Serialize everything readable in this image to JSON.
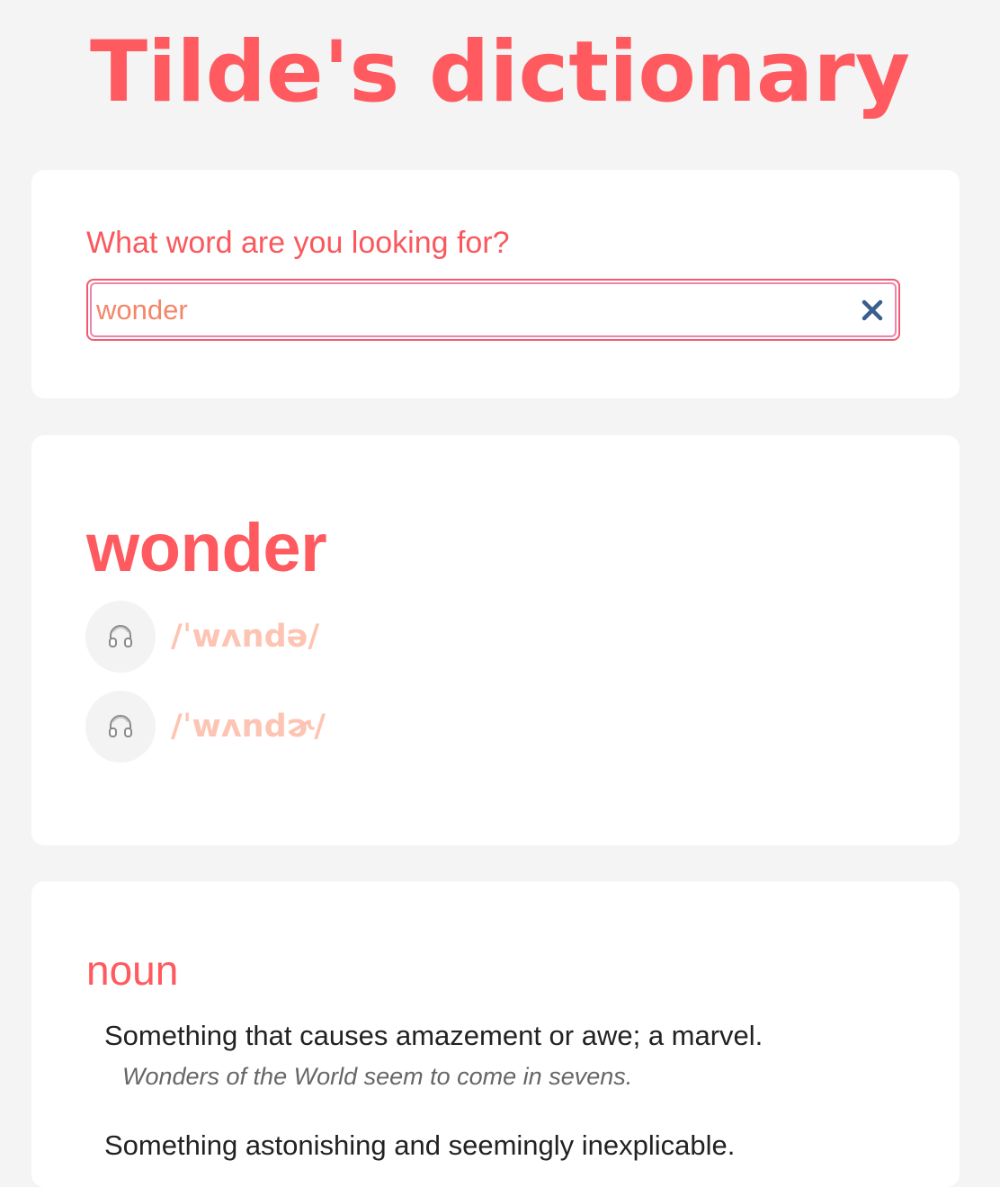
{
  "app": {
    "title": "Tilde's dictionary"
  },
  "search": {
    "label": "What word are you looking for?",
    "value": "wonder",
    "clear_icon": "close-x-icon"
  },
  "entry": {
    "word": "wonder",
    "phonetics": [
      {
        "text": "/ˈwʌndə/",
        "icon": "headphones-icon"
      },
      {
        "text": "/ˈwʌndɚ/",
        "icon": "headphones-icon"
      }
    ]
  },
  "meanings": [
    {
      "part_of_speech": "noun",
      "definitions": [
        {
          "definition": "Something that causes amazement or awe; a marvel.",
          "example": "Wonders of the World seem to come in sevens."
        },
        {
          "definition": "Something astonishing and seemingly inexplicable."
        }
      ]
    }
  ],
  "colors": {
    "accent": "#fe5a5f",
    "phonetic": "#fdc4b3",
    "input_text": "#f3866a",
    "clear_icon": "#3b5e8c",
    "background": "#f4f4f4",
    "card": "#ffffff"
  }
}
